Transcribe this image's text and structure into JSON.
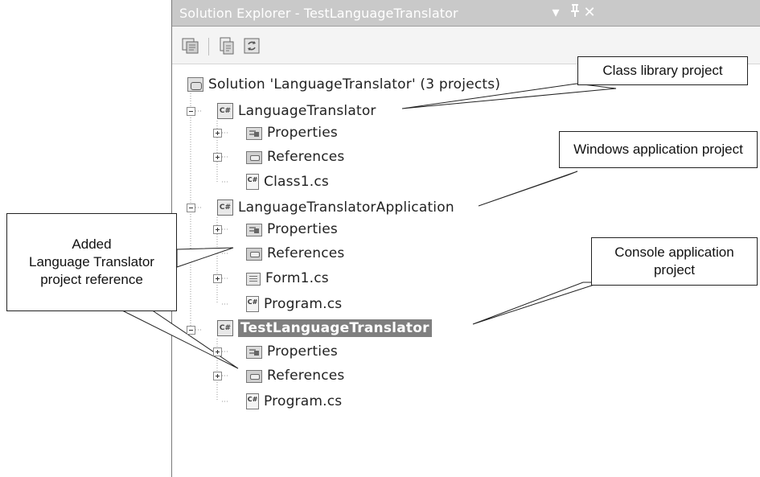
{
  "panel": {
    "title": "Solution Explorer - TestLanguageTranslator",
    "window_controls": {
      "dropdown": "▾",
      "pin": "ᵖ",
      "close": "✕"
    }
  },
  "toolbar": {
    "icons": [
      "copy-icon",
      "properties-icon",
      "refresh-icon"
    ]
  },
  "tree": {
    "solution": "Solution 'LanguageTranslator' (3 projects)",
    "projects": [
      {
        "name": "LanguageTranslator",
        "items": [
          "Properties",
          "References",
          "Class1.cs"
        ]
      },
      {
        "name": "LanguageTranslatorApplication",
        "items": [
          "Properties",
          "References",
          "Form1.cs",
          "Program.cs"
        ]
      },
      {
        "name": "TestLanguageTranslator",
        "items": [
          "Properties",
          "References",
          "Program.cs"
        ]
      }
    ]
  },
  "callouts": {
    "class_library": "Class library project",
    "windows_app": "Windows application project",
    "added_ref": "Added\nLanguage Translator\nproject reference",
    "console_app": "Console application\nproject"
  }
}
